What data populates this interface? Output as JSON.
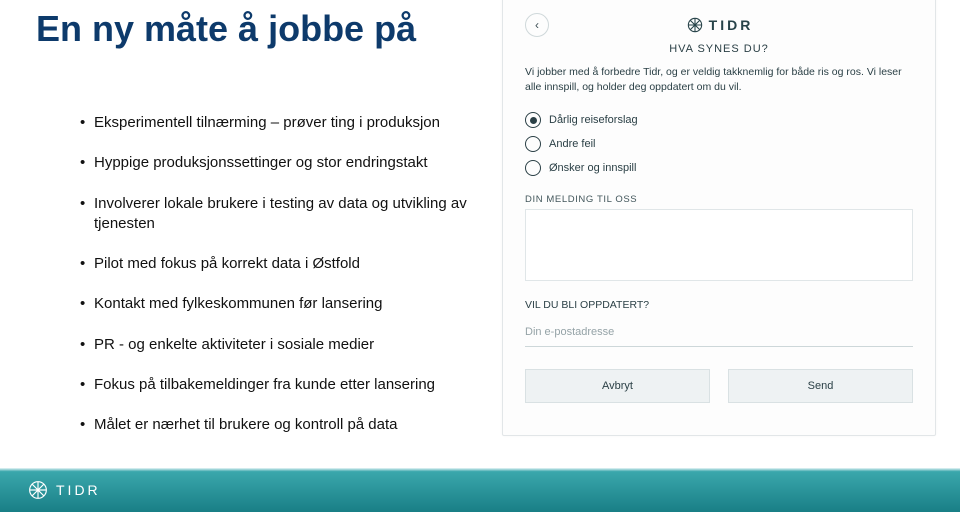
{
  "title": "En ny måte å jobbe på",
  "bullets": [
    "Eksperimentell tilnærming – prøver ting i produksjon",
    "Hyppige produksjonssettinger og stor endringstakt",
    "Involverer lokale brukere i testing av data og utvikling av tjenesten",
    "Pilot med fokus på korrekt data i Østfold",
    "Kontakt med fylkeskommunen før lansering",
    "PR - og enkelte aktiviteter i sosiale medier",
    "Fokus på tilbakemeldinger fra kunde etter lansering",
    "Målet er nærhet til brukere  og kontroll på data"
  ],
  "app": {
    "brand": "TIDR",
    "header": "HVA SYNES DU?",
    "intro": "Vi jobber med å forbedre Tidr, og er veldig takknemlig for både ris og ros. Vi leser alle innspill, og holder deg oppdatert om du vil.",
    "options": [
      {
        "label": "Dårlig reiseforslag",
        "selected": true
      },
      {
        "label": "Andre feil",
        "selected": false
      },
      {
        "label": "Ønsker og innspill",
        "selected": false
      }
    ],
    "message_label": "DIN MELDING TIL OSS",
    "followup_q": "VIL DU BLI OPPDATERT?",
    "email_placeholder": "Din e-postadresse",
    "cancel": "Avbryt",
    "send": "Send"
  },
  "footer": {
    "brand": "TIDR"
  }
}
